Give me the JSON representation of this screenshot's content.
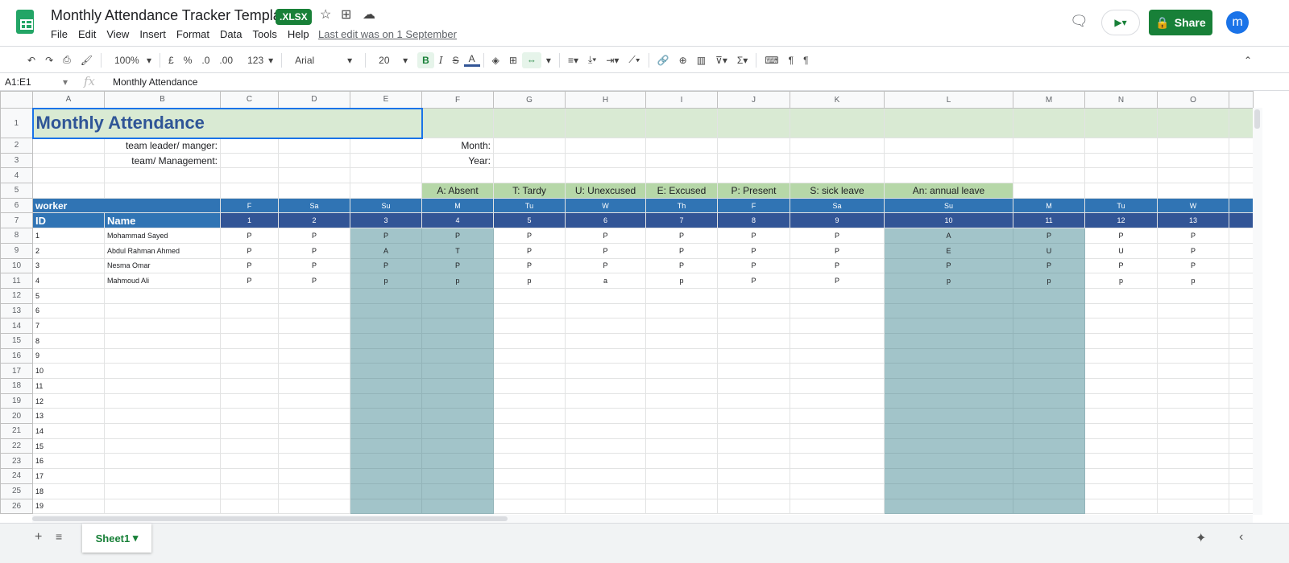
{
  "app": {
    "title": "Monthly Attendance Tracker Template",
    "badge": ".XLSX",
    "menu": [
      "File",
      "Edit",
      "View",
      "Insert",
      "Format",
      "Data",
      "Tools",
      "Help"
    ],
    "last_edit": "Last edit was on 1 September",
    "share": "Share",
    "avatar": "m"
  },
  "toolbar": {
    "zoom": "100%",
    "currency": "£",
    "percent": "%",
    "dec_less": ".0",
    "dec_more": ".00",
    "format": "123",
    "font": "Arial",
    "size": "20",
    "bold": "B",
    "italic": "I",
    "strike": "S",
    "text_color": "A"
  },
  "formula": {
    "name_box": "A1:E1",
    "fx": "fx",
    "content": "Monthly Attendance"
  },
  "columns": [
    "A",
    "B",
    "C",
    "D",
    "E",
    "F",
    "G",
    "H",
    "I",
    "J",
    "K",
    "L",
    "M",
    "N",
    "O"
  ],
  "sheet": {
    "title": "Monthly Attendance",
    "leader_label": "team leader/ manger:",
    "mgmt_label": "team/ Management:",
    "month_label": "Month:",
    "year_label": "Year:",
    "legend": [
      "A: Absent",
      "T: Tardy",
      "U: Unexcused",
      "E: Excused",
      "P: Present",
      "S: sick leave",
      "An: annual leave"
    ],
    "worker": "worker",
    "id_header": "ID",
    "name_header": "Name",
    "days": [
      "F",
      "Sa",
      "Su",
      "M",
      "Tu",
      "W",
      "Th",
      "F",
      "Sa",
      "Su",
      "M",
      "Tu",
      "W"
    ],
    "dates": [
      "1",
      "2",
      "3",
      "4",
      "5",
      "6",
      "7",
      "8",
      "9",
      "10",
      "11",
      "12",
      "13"
    ],
    "workers": [
      {
        "id": "1",
        "name": "Mohammad Sayed",
        "att": [
          "P",
          "P",
          "P",
          "P",
          "P",
          "P",
          "P",
          "P",
          "P",
          "A",
          "P",
          "P",
          "P"
        ]
      },
      {
        "id": "2",
        "name": "Abdul Rahman Ahmed",
        "att": [
          "P",
          "P",
          "A",
          "T",
          "P",
          "P",
          "P",
          "P",
          "P",
          "E",
          "U",
          "U",
          "P"
        ]
      },
      {
        "id": "3",
        "name": "Nesma Omar",
        "att": [
          "P",
          "P",
          "P",
          "P",
          "P",
          "P",
          "P",
          "P",
          "P",
          "P",
          "P",
          "P",
          "P"
        ]
      },
      {
        "id": "4",
        "name": "Mahmoud Ali",
        "att": [
          "P",
          "P",
          "p",
          "p",
          "p",
          "a",
          "p",
          "P",
          "P",
          "p",
          "p",
          "p",
          "p"
        ]
      }
    ],
    "extra_ids": [
      "5",
      "6",
      "7",
      "8",
      "9",
      "10",
      "11",
      "12",
      "13",
      "14",
      "15",
      "16",
      "17",
      "18",
      "19"
    ]
  },
  "sheet_tab": "Sheet1"
}
